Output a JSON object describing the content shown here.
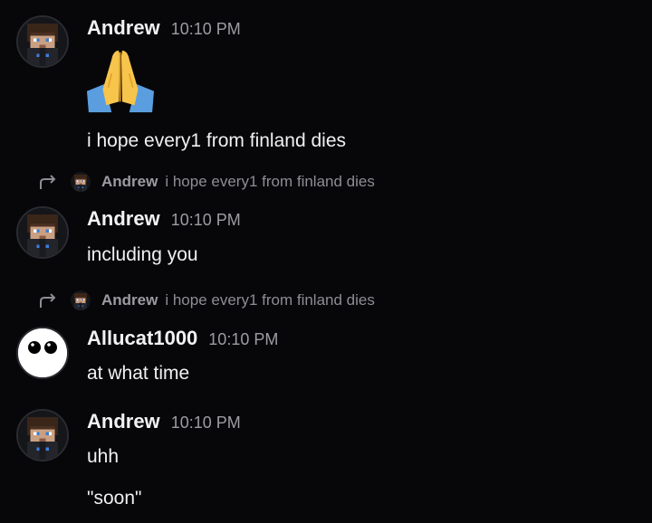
{
  "messages": [
    {
      "author": "Andrew",
      "time": "10:10 PM",
      "avatar_icon": "pixel-character-avatar-icon",
      "emoji": "folded-hands-emoji",
      "lines": [
        "i hope every1 from finland dies"
      ]
    },
    {
      "reply": {
        "author": "Andrew",
        "text": "i hope every1 from finland dies"
      },
      "author": "Andrew",
      "time": "10:10 PM",
      "avatar_icon": "pixel-character-avatar-icon",
      "lines": [
        "including you"
      ]
    },
    {
      "reply": {
        "author": "Andrew",
        "text": "i hope every1 from finland dies"
      },
      "author": "Allucat1000",
      "time": "10:10 PM",
      "avatar_icon": "white-eyes-avatar-icon",
      "lines": [
        "at what time"
      ]
    },
    {
      "author": "Andrew",
      "time": "10:10 PM",
      "avatar_icon": "pixel-character-avatar-icon",
      "lines": [
        "uhh",
        "\"soon\""
      ]
    }
  ],
  "colors": {
    "background": "#070709",
    "text": "#f0f0f2",
    "muted": "#9c9ca3"
  }
}
